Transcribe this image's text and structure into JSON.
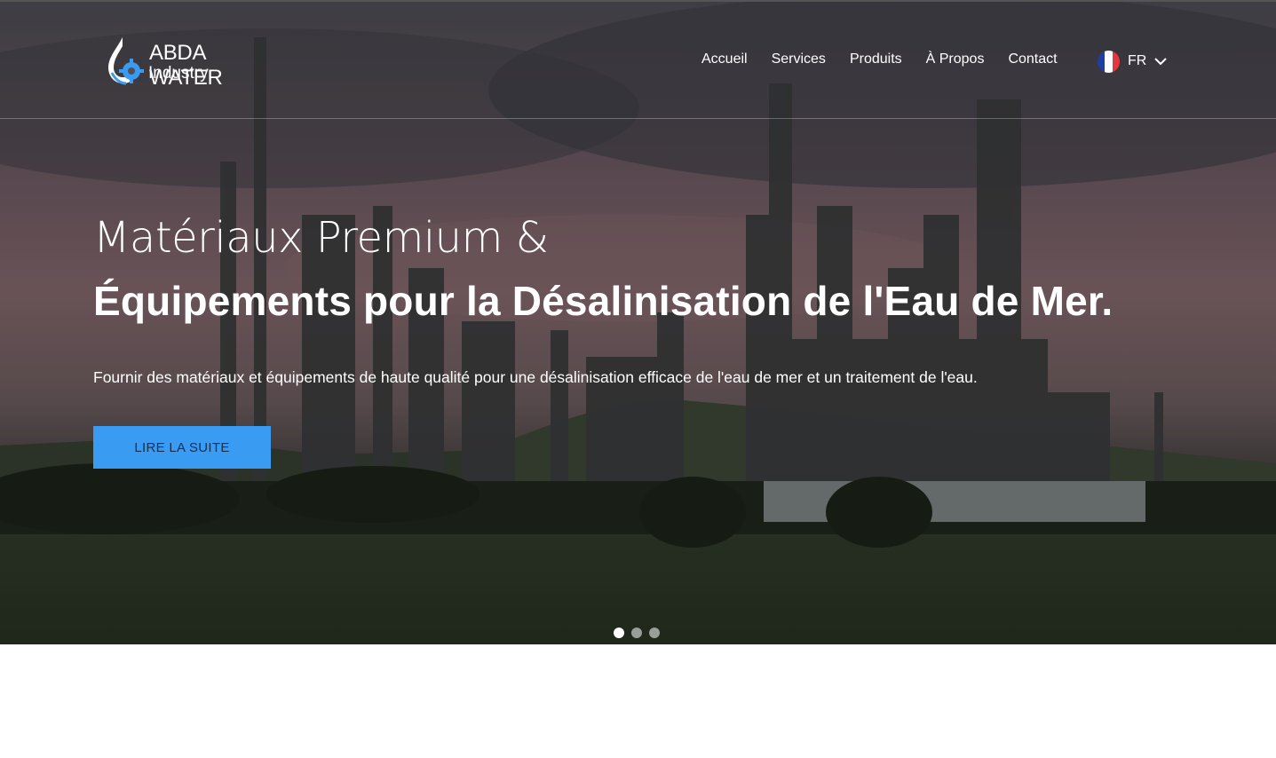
{
  "brand": {
    "name": "ABDA WATER",
    "tagline": "Industry",
    "logo_icon": "water-drop-gear-icon",
    "accent": "#3a9bf2"
  },
  "nav": {
    "items": [
      {
        "label": "Accueil"
      },
      {
        "label": "Services"
      },
      {
        "label": "Produits"
      },
      {
        "label": "À Propos"
      },
      {
        "label": "Contact"
      }
    ]
  },
  "language": {
    "code": "FR",
    "flag_icon": "france-flag-icon",
    "flag_colors": [
      "#1e3fa0",
      "#ffffff",
      "#e03a3e"
    ],
    "chevron_icon": "chevron-down-icon"
  },
  "hero": {
    "title_line1": "Matériaux Premium &",
    "title_line2": "Équipements pour la Désalinisation de l'Eau de Mer.",
    "lead": "Fournir des matériaux et équipements de haute qualité pour une désalinisation efficace de l'eau de mer et un traitement de l'eau.",
    "cta_label": "LIRE LA SUITE",
    "cta_color": "#3a9bf2",
    "background_image": "refinery-at-dusk",
    "slide_count": 3,
    "active_slide": 1
  }
}
